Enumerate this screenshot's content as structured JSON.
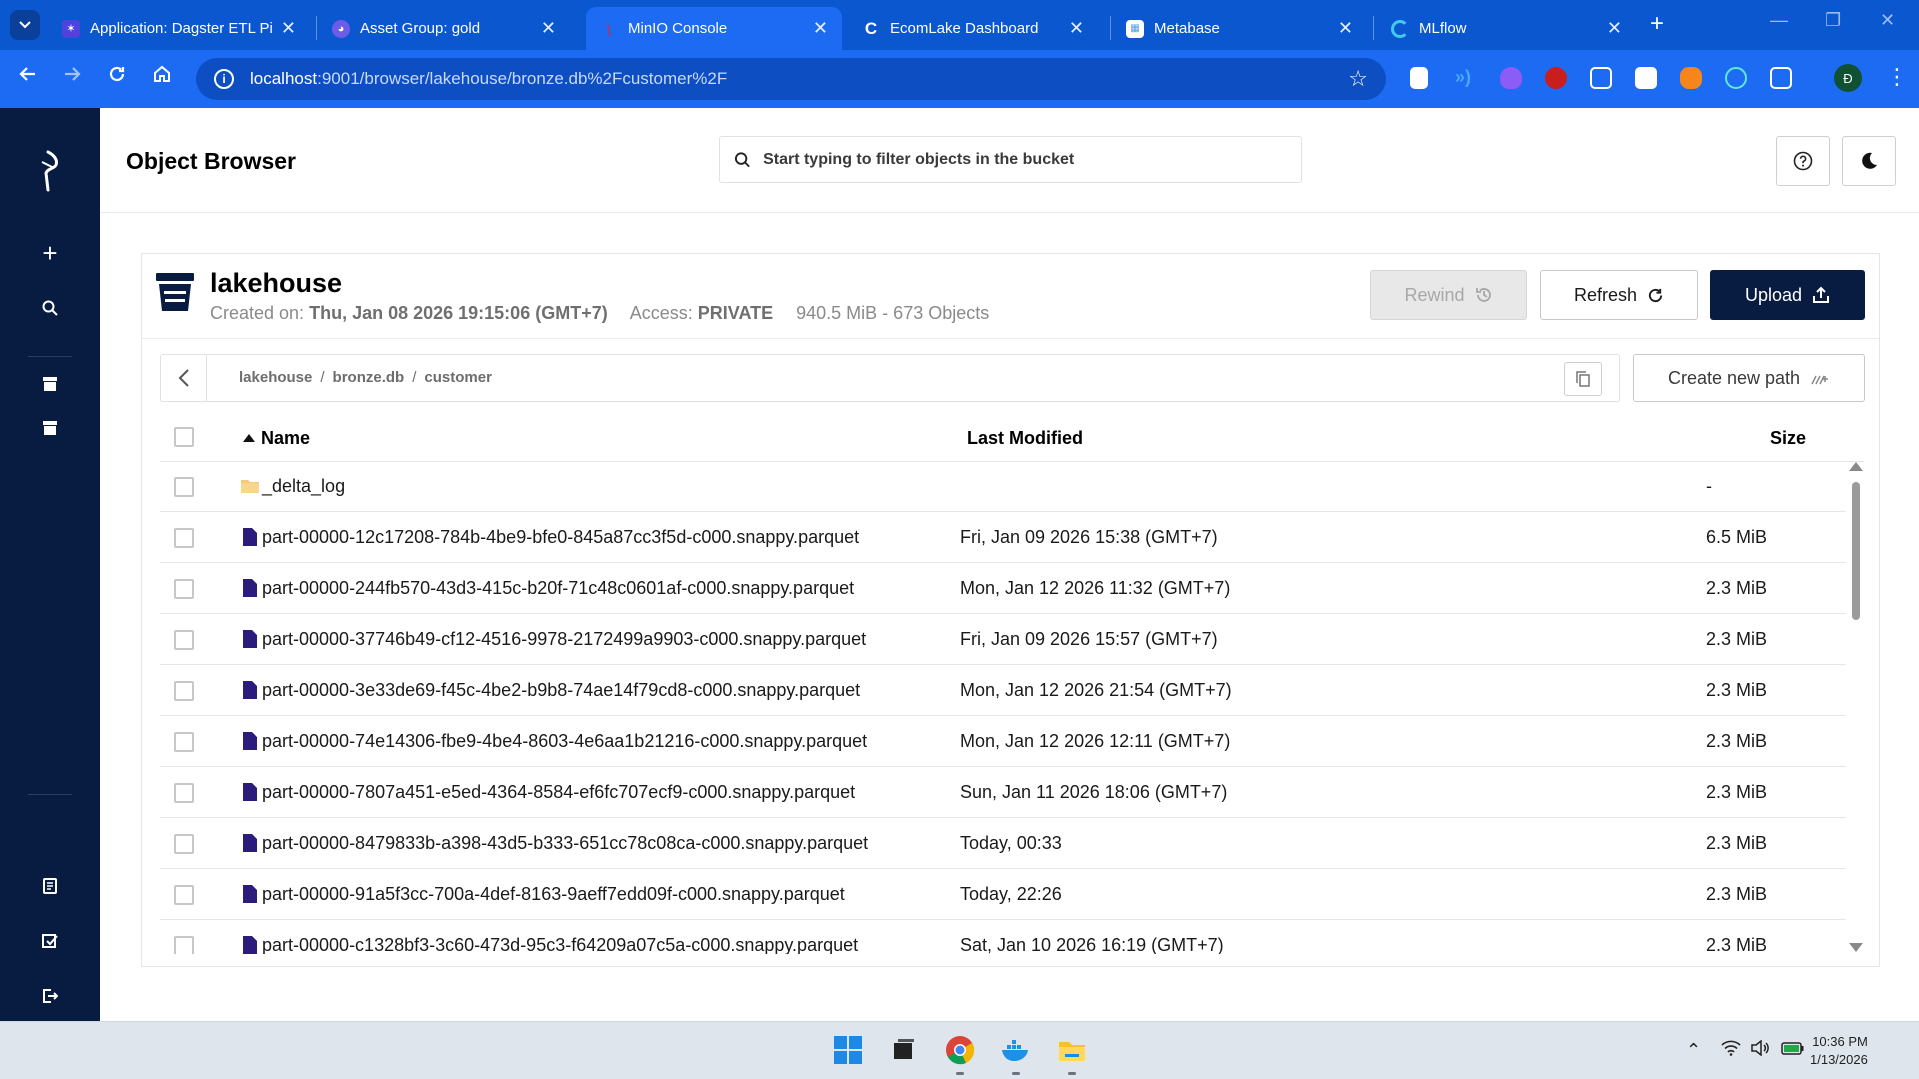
{
  "browser": {
    "tabs": [
      {
        "title": "Application: Dagster ETL Pi",
        "active": false
      },
      {
        "title": "Asset Group: gold",
        "active": false
      },
      {
        "title": "MinIO Console",
        "active": true
      },
      {
        "title": "EcomLake Dashboard",
        "active": false
      },
      {
        "title": "Metabase",
        "active": false
      },
      {
        "title": "MLflow",
        "active": false
      }
    ],
    "url_host": "localhost",
    "url_path": ":9001/browser/lakehouse/bronze.db%2Fcustomer%2F",
    "profile_initial": "Đ",
    "accent": "#1c6bf2"
  },
  "sidebar": {
    "icons": [
      "minio-logo-icon",
      "add-icon",
      "search-icon",
      "bucket-icon",
      "bucket-icon",
      "docs-icon",
      "license-icon",
      "logout-icon"
    ],
    "bg": "#081c42"
  },
  "header": {
    "title": "Object Browser",
    "filter_placeholder": "Start typing to filter objects in the bucket"
  },
  "bucket": {
    "name": "lakehouse",
    "created_label": "Created on:",
    "created_value": "Thu, Jan 08 2026 19:15:06 (GMT+7)",
    "access_label": "Access:",
    "access_value": "PRIVATE",
    "usage": "940.5 MiB - 673 Objects",
    "buttons": {
      "rewind": "Rewind",
      "refresh": "Refresh",
      "upload": "Upload"
    }
  },
  "breadcrumb": {
    "parts": [
      "lakehouse",
      "bronze.db",
      "customer"
    ],
    "sep": "/",
    "new_path": "Create new path"
  },
  "table": {
    "columns": {
      "name": "Name",
      "modified": "Last Modified",
      "size": "Size"
    },
    "rows": [
      {
        "type": "folder",
        "name": "_delta_log",
        "modified": "",
        "size": "-"
      },
      {
        "type": "file",
        "name": "part-00000-12c17208-784b-4be9-bfe0-845a87cc3f5d-c000.snappy.parquet",
        "modified": "Fri, Jan 09 2026 15:38 (GMT+7)",
        "size": "6.5 MiB"
      },
      {
        "type": "file",
        "name": "part-00000-244fb570-43d3-415c-b20f-71c48c0601af-c000.snappy.parquet",
        "modified": "Mon, Jan 12 2026 11:32 (GMT+7)",
        "size": "2.3 MiB"
      },
      {
        "type": "file",
        "name": "part-00000-37746b49-cf12-4516-9978-2172499a9903-c000.snappy.parquet",
        "modified": "Fri, Jan 09 2026 15:57 (GMT+7)",
        "size": "2.3 MiB"
      },
      {
        "type": "file",
        "name": "part-00000-3e33de69-f45c-4be2-b9b8-74ae14f79cd8-c000.snappy.parquet",
        "modified": "Mon, Jan 12 2026 21:54 (GMT+7)",
        "size": "2.3 MiB"
      },
      {
        "type": "file",
        "name": "part-00000-74e14306-fbe9-4be4-8603-4e6aa1b21216-c000.snappy.parquet",
        "modified": "Mon, Jan 12 2026 12:11 (GMT+7)",
        "size": "2.3 MiB"
      },
      {
        "type": "file",
        "name": "part-00000-7807a451-e5ed-4364-8584-ef6fc707ecf9-c000.snappy.parquet",
        "modified": "Sun, Jan 11 2026 18:06 (GMT+7)",
        "size": "2.3 MiB"
      },
      {
        "type": "file",
        "name": "part-00000-8479833b-a398-43d5-b333-651cc78c08ca-c000.snappy.parquet",
        "modified": "Today, 00:33",
        "size": "2.3 MiB"
      },
      {
        "type": "file",
        "name": "part-00000-91a5f3cc-700a-4def-8163-9aeff7edd09f-c000.snappy.parquet",
        "modified": "Today, 22:26",
        "size": "2.3 MiB"
      },
      {
        "type": "file",
        "name": "part-00000-c1328bf3-3c60-473d-95c3-f64209a07c5a-c000.snappy.parquet",
        "modified": "Sat, Jan 10 2026 16:19 (GMT+7)",
        "size": "2.3 MiB"
      }
    ]
  },
  "taskbar": {
    "time": "10:36 PM",
    "date": "1/13/2026"
  }
}
